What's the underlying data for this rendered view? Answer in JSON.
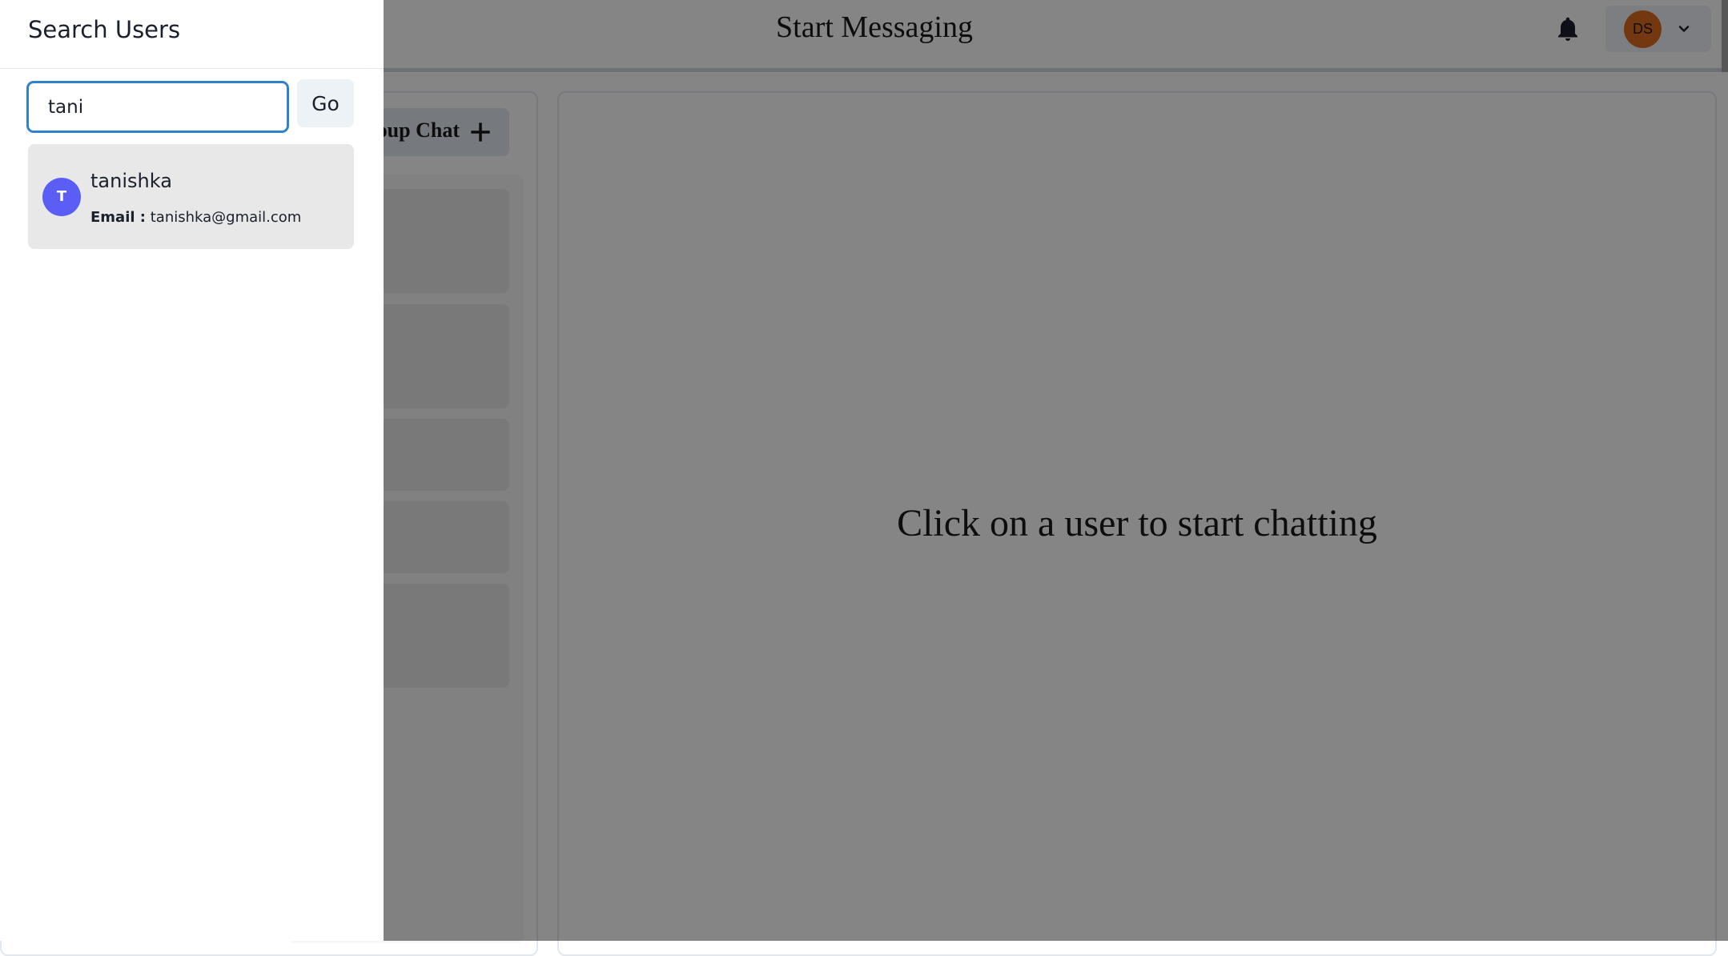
{
  "header": {
    "title": "Start Messaging",
    "profile_initials": "DS",
    "bell_icon": "bell-icon",
    "chevron_icon": "chevron-down-icon"
  },
  "my_chats": {
    "group_chat_label": "New Group Chat"
  },
  "chatbox": {
    "empty_message": "Click on a user to start chatting"
  },
  "drawer": {
    "title": "Search Users",
    "search_value": "tani",
    "go_label": "Go",
    "results": [
      {
        "initial": "T",
        "name": "tanishka",
        "email_label": "Email :",
        "email": "tanishka@gmail.com"
      }
    ]
  },
  "colors": {
    "avatar_ds": "#dd6b20",
    "avatar_t": "#5a5ef5",
    "input_focus": "#3182ce"
  }
}
